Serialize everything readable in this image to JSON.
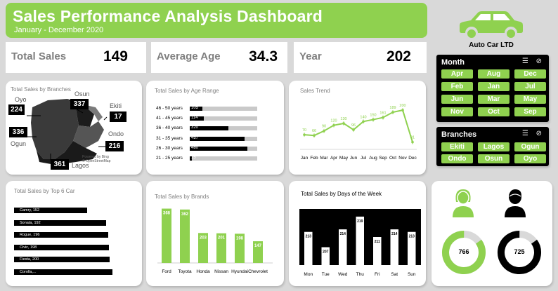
{
  "header": {
    "title": "Sales Performance Analysis Dashboard",
    "subtitle": "January - December 2020"
  },
  "brand": {
    "name": "Auto Car LTD"
  },
  "kpis": {
    "total_sales": {
      "label": "Total Sales",
      "value": "149"
    },
    "average_age": {
      "label": "Average Age",
      "value": "34.3"
    },
    "year": {
      "label": "Year",
      "value": "202"
    }
  },
  "month_slicer": {
    "title": "Month",
    "items": [
      "Apr",
      "Aug",
      "Dec",
      "Feb",
      "Jan",
      "Jul",
      "Jun",
      "Mar",
      "May",
      "Nov",
      "Oct",
      "Sep"
    ]
  },
  "branch_slicer": {
    "title": "Branches",
    "items": [
      "Ekiti",
      "Lagos",
      "Ogun",
      "Ondo",
      "Osun",
      "Oyo"
    ]
  },
  "branches_map": {
    "title": "Total Sales by Branches",
    "credit": "Powered by Bing\n© OpenStreetMap",
    "branches": [
      {
        "name": "Oyo",
        "value": "224"
      },
      {
        "name": "Osun",
        "value": "337"
      },
      {
        "name": "Ekiti",
        "value": "17"
      },
      {
        "name": "Ondo",
        "value": "216"
      },
      {
        "name": "Ogun",
        "value": "336"
      },
      {
        "name": "Lagos",
        "value": "361"
      }
    ]
  },
  "age_chart": {
    "title": "Total Sales by Age Range",
    "max": 560,
    "rows": [
      {
        "label": "46 - 50 years",
        "value": 105
      },
      {
        "label": "41 - 45 years",
        "value": 114
      },
      {
        "label": "36 - 40 years",
        "value": 320
      },
      {
        "label": "31 - 35 years",
        "value": 457
      },
      {
        "label": "26 - 30 years",
        "value": 480
      },
      {
        "label": "21 - 25 years",
        "value": 15
      }
    ]
  },
  "trend_chart": {
    "title": "Sales Trend",
    "months": [
      "Jan",
      "Feb",
      "Mar",
      "Apr",
      "May",
      "Jun",
      "Jul",
      "Aug",
      "Sep",
      "Oct",
      "Nov",
      "Dec"
    ],
    "values": [
      70,
      66,
      90,
      120,
      130,
      96,
      140,
      150,
      161,
      189,
      200,
      31
    ],
    "ymax": 230,
    "color": "#8fd14f"
  },
  "top_cars": {
    "title": "Total Sales by Top  6 Car",
    "max": 220,
    "items": [
      {
        "label": "Camry, 152",
        "value": 152
      },
      {
        "label": "Sonata, 192",
        "value": 192
      },
      {
        "label": "Rogue, 196",
        "value": 196
      },
      {
        "label": "Civic, 198",
        "value": 198
      },
      {
        "label": "Fiesta, 200",
        "value": 200
      },
      {
        "label": "Corolla,...",
        "value": 205
      }
    ]
  },
  "brands_chart": {
    "title": "Total Sales by Brands",
    "categories": [
      "Ford",
      "Toyota",
      "Honda",
      "Nissan",
      "Hyundai",
      "Chevrolet"
    ],
    "values": [
      368,
      362,
      203,
      201,
      198,
      147
    ],
    "ymax": 380,
    "color": "#8fd14f"
  },
  "days_chart": {
    "title": "Total Sales by Days of the Week",
    "categories": [
      "Mon",
      "Tue",
      "Wed",
      "Thu",
      "Fri",
      "Sat",
      "Sun"
    ],
    "values": [
      213,
      207,
      214,
      219,
      211,
      214,
      213
    ],
    "ymin": 200,
    "ymax": 222
  },
  "gender": {
    "female": {
      "value": "766",
      "fraction": 0.85,
      "color": "#8fd14f"
    },
    "male": {
      "value": "725",
      "fraction": 0.85,
      "color": "#000000"
    }
  },
  "chart_data": [
    {
      "type": "bar",
      "title": "Total Sales by Age Range",
      "categories": [
        "46 - 50 years",
        "41 - 45 years",
        "36 - 40 years",
        "31 - 35 years",
        "26 - 30 years",
        "21 - 25 years"
      ],
      "values": [
        105,
        114,
        320,
        457,
        480,
        15
      ]
    },
    {
      "type": "line",
      "title": "Sales Trend",
      "x": [
        "Jan",
        "Feb",
        "Mar",
        "Apr",
        "May",
        "Jun",
        "Jul",
        "Aug",
        "Sep",
        "Oct",
        "Nov",
        "Dec"
      ],
      "values": [
        70,
        66,
        90,
        120,
        130,
        96,
        140,
        150,
        161,
        189,
        200,
        31
      ]
    },
    {
      "type": "bar",
      "title": "Total Sales by Top  6 Car",
      "categories": [
        "Camry",
        "Sonata",
        "Rogue",
        "Civic",
        "Fiesta",
        "Corolla"
      ],
      "values": [
        152,
        192,
        196,
        198,
        200,
        null
      ]
    },
    {
      "type": "bar",
      "title": "Total Sales by Brands",
      "categories": [
        "Ford",
        "Toyota",
        "Honda",
        "Nissan",
        "Hyundai",
        "Chevrolet"
      ],
      "values": [
        368,
        362,
        203,
        201,
        198,
        147
      ]
    },
    {
      "type": "bar",
      "title": "Total Sales by Days of the Week",
      "categories": [
        "Mon",
        "Tue",
        "Wed",
        "Thu",
        "Fri",
        "Sat",
        "Sun"
      ],
      "values": [
        213,
        207,
        214,
        219,
        211,
        214,
        213
      ]
    },
    {
      "type": "pie",
      "categories": [
        "Female",
        "Male"
      ],
      "values": [
        766,
        725
      ]
    }
  ]
}
